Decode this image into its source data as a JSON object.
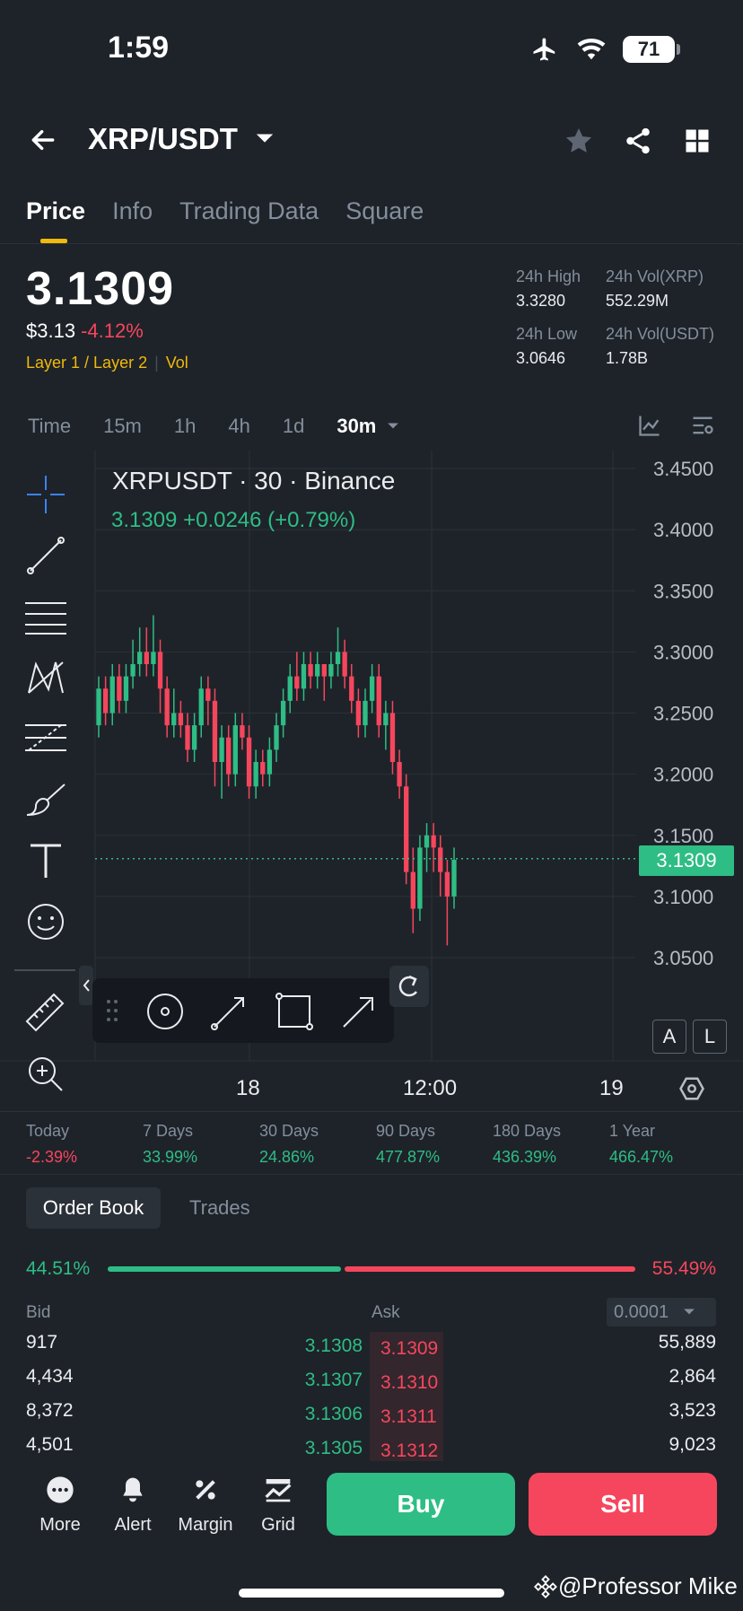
{
  "status": {
    "time": "1:59",
    "battery": "71"
  },
  "header": {
    "pair": "XRP/USDT"
  },
  "tabs": [
    "Price",
    "Info",
    "Trading Data",
    "Square"
  ],
  "ticker": {
    "price": "3.1309",
    "usd_price": "$3.13",
    "change_pct": "-4.12%",
    "tag1": "Layer 1 / Layer 2",
    "tag2": "Vol",
    "high_label": "24h High",
    "high": "3.3280",
    "vol_xrp_label": "24h Vol(XRP)",
    "vol_xrp": "552.29M",
    "low_label": "24h Low",
    "low": "3.0646",
    "vol_usdt_label": "24h Vol(USDT)",
    "vol_usdt": "1.78B"
  },
  "intervals": [
    "Time",
    "15m",
    "1h",
    "4h",
    "1d"
  ],
  "interval_selected": "30m",
  "chart": {
    "legend_title": "XRPUSDT · 30 · Binance",
    "legend_values": "3.1309  +0.0246 (+0.79%)",
    "current_price": "3.1309",
    "x_labels": [
      "18",
      "12:00",
      "19"
    ],
    "btn_a": "A",
    "btn_l": "L"
  },
  "chart_data": {
    "type": "candlestick",
    "title": "XRPUSDT · 30 · Binance",
    "x_ticks": [
      "18",
      "12:00",
      "19"
    ],
    "y_ticks": [
      3.45,
      3.4,
      3.35,
      3.3,
      3.25,
      3.2,
      3.15,
      3.1,
      3.05
    ],
    "ylim": [
      3.02,
      3.46
    ],
    "last_price": 3.1309,
    "candles": [
      [
        3.24,
        3.27,
        3.28,
        3.23
      ],
      [
        3.27,
        3.25,
        3.28,
        3.24
      ],
      [
        3.25,
        3.28,
        3.29,
        3.24
      ],
      [
        3.28,
        3.26,
        3.29,
        3.25
      ],
      [
        3.26,
        3.28,
        3.29,
        3.25
      ],
      [
        3.28,
        3.29,
        3.31,
        3.27
      ],
      [
        3.29,
        3.3,
        3.32,
        3.28
      ],
      [
        3.3,
        3.29,
        3.32,
        3.28
      ],
      [
        3.29,
        3.3,
        3.33,
        3.28
      ],
      [
        3.3,
        3.27,
        3.31,
        3.25
      ],
      [
        3.27,
        3.24,
        3.28,
        3.23
      ],
      [
        3.24,
        3.25,
        3.27,
        3.23
      ],
      [
        3.25,
        3.24,
        3.26,
        3.23
      ],
      [
        3.24,
        3.22,
        3.25,
        3.21
      ],
      [
        3.22,
        3.24,
        3.25,
        3.21
      ],
      [
        3.24,
        3.27,
        3.28,
        3.23
      ],
      [
        3.27,
        3.26,
        3.28,
        3.24
      ],
      [
        3.26,
        3.21,
        3.27,
        3.19
      ],
      [
        3.21,
        3.23,
        3.24,
        3.18
      ],
      [
        3.23,
        3.2,
        3.24,
        3.19
      ],
      [
        3.2,
        3.24,
        3.25,
        3.19
      ],
      [
        3.24,
        3.23,
        3.25,
        3.22
      ],
      [
        3.23,
        3.19,
        3.24,
        3.18
      ],
      [
        3.19,
        3.21,
        3.22,
        3.18
      ],
      [
        3.21,
        3.2,
        3.22,
        3.19
      ],
      [
        3.2,
        3.22,
        3.23,
        3.19
      ],
      [
        3.22,
        3.24,
        3.25,
        3.21
      ],
      [
        3.24,
        3.26,
        3.27,
        3.23
      ],
      [
        3.26,
        3.28,
        3.29,
        3.25
      ],
      [
        3.28,
        3.27,
        3.3,
        3.26
      ],
      [
        3.27,
        3.29,
        3.3,
        3.26
      ],
      [
        3.29,
        3.28,
        3.3,
        3.27
      ],
      [
        3.28,
        3.29,
        3.3,
        3.27
      ],
      [
        3.29,
        3.28,
        3.29,
        3.26
      ],
      [
        3.28,
        3.29,
        3.3,
        3.27
      ],
      [
        3.29,
        3.3,
        3.32,
        3.28
      ],
      [
        3.3,
        3.28,
        3.31,
        3.27
      ],
      [
        3.28,
        3.26,
        3.29,
        3.25
      ],
      [
        3.26,
        3.24,
        3.27,
        3.23
      ],
      [
        3.24,
        3.26,
        3.27,
        3.23
      ],
      [
        3.26,
        3.28,
        3.29,
        3.25
      ],
      [
        3.28,
        3.24,
        3.29,
        3.23
      ],
      [
        3.24,
        3.25,
        3.26,
        3.22
      ],
      [
        3.25,
        3.21,
        3.26,
        3.2
      ],
      [
        3.21,
        3.19,
        3.22,
        3.18
      ],
      [
        3.19,
        3.12,
        3.2,
        3.11
      ],
      [
        3.12,
        3.09,
        3.14,
        3.07
      ],
      [
        3.09,
        3.14,
        3.15,
        3.08
      ],
      [
        3.14,
        3.15,
        3.16,
        3.12
      ],
      [
        3.15,
        3.14,
        3.16,
        3.12
      ],
      [
        3.14,
        3.12,
        3.15,
        3.1
      ],
      [
        3.12,
        3.1,
        3.13,
        3.06
      ],
      [
        3.1,
        3.13,
        3.14,
        3.09
      ]
    ]
  },
  "performance": [
    {
      "label": "Today",
      "value": "-2.39%",
      "dir": "neg"
    },
    {
      "label": "7 Days",
      "value": "33.99%",
      "dir": "pos"
    },
    {
      "label": "30 Days",
      "value": "24.86%",
      "dir": "pos"
    },
    {
      "label": "90 Days",
      "value": "477.87%",
      "dir": "pos"
    },
    {
      "label": "180 Days",
      "value": "436.39%",
      "dir": "pos"
    },
    {
      "label": "1 Year",
      "value": "466.47%",
      "dir": "pos"
    }
  ],
  "orderbook": {
    "tab_active": "Order Book",
    "tab_other": "Trades",
    "buy_ratio": "44.51%",
    "sell_ratio": "55.49%",
    "bid_label": "Bid",
    "ask_label": "Ask",
    "precision": "0.0001",
    "rows": [
      {
        "bid_qty": "917",
        "bid_px": "3.1308",
        "ask_px": "3.1309",
        "ask_qty": "55,889"
      },
      {
        "bid_qty": "4,434",
        "bid_px": "3.1307",
        "ask_px": "3.1310",
        "ask_qty": "2,864"
      },
      {
        "bid_qty": "8,372",
        "bid_px": "3.1306",
        "ask_px": "3.1311",
        "ask_qty": "3,523"
      },
      {
        "bid_qty": "4,501",
        "bid_px": "3.1305",
        "ask_px": "3.1312",
        "ask_qty": "9,023"
      }
    ]
  },
  "bottom_nav": {
    "more": "More",
    "alert": "Alert",
    "margin": "Margin",
    "grid": "Grid",
    "buy": "Buy",
    "sell": "Sell"
  },
  "watermark": "@Professor Mike",
  "colors": {
    "green": "#2ebd85",
    "red": "#f6465d",
    "yellow": "#f0b90b",
    "bg": "#1e2329"
  }
}
